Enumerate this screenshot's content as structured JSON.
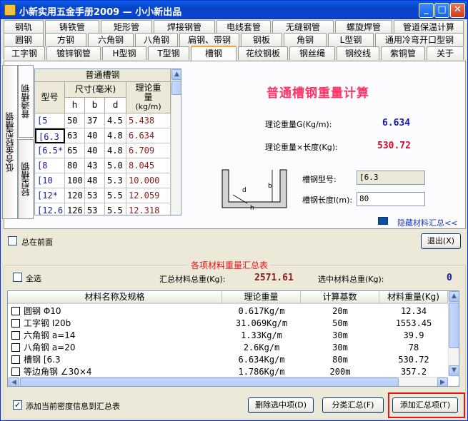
{
  "window": {
    "title": "小新实用五金手册2009 — 小小新出品",
    "min": "_",
    "max": "□",
    "close": "✕"
  },
  "tabs_row1": [
    "钢轨",
    "铸铁管",
    "矩形管",
    "焊接钢管",
    "电线套管",
    "无缝钢管",
    "螺旋焊管",
    "管道保温计算"
  ],
  "tabs_row2": [
    "圆钢",
    "方钢",
    "六角钢",
    "八角钢",
    "扁钢、带钢",
    "钢板",
    "角钢",
    "L型钢",
    "通用冷弯开口型钢"
  ],
  "tabs_row3": [
    "工字钢",
    "镀锌钢管",
    "H型钢",
    "T型钢",
    "槽钢",
    "花纹钢板",
    "钢丝绳",
    "钢绞线",
    "紫铜管",
    "关于"
  ],
  "vtabs": [
    "普通槽钢",
    "轻型槽钢",
    "低合金轻型槽钢"
  ],
  "grid": {
    "group_header": "普通槽钢",
    "col_model": "型号",
    "col_size": "尺寸(毫米)",
    "col_weight": "理论重量",
    "col_unit": "(kg/m)",
    "subcols": [
      "h",
      "b",
      "d"
    ],
    "rows": [
      [
        "[5",
        "50",
        "37",
        "4.5",
        "5.438"
      ],
      [
        "[6.3",
        "63",
        "40",
        "4.8",
        "6.634"
      ],
      [
        "[6.5*",
        "65",
        "40",
        "4.8",
        "6.709"
      ],
      [
        "[8",
        "80",
        "43",
        "5.0",
        "8.045"
      ],
      [
        "[10",
        "100",
        "48",
        "5.3",
        "10.000"
      ],
      [
        "[12*",
        "120",
        "53",
        "5.5",
        "12.059"
      ],
      [
        "[12.6",
        "126",
        "53",
        "5.5",
        "12.318"
      ]
    ]
  },
  "calc": {
    "heading": "普通槽钢重量计算",
    "weight_label": "理论重量G(Kg/m):",
    "weight_value": "6.634",
    "total_label": "理论重量×长度(Kg):",
    "total_value": "530.72",
    "model_label": "槽钢型号:",
    "model_value": "[6.3",
    "length_label": "槽钢长度l(m):",
    "length_value": "80",
    "hide_summary": "隐藏材料汇总<<",
    "diagram_labels": [
      "b",
      "d",
      "h"
    ]
  },
  "topmost_label": "总在前面",
  "exit_button": "退出(X)",
  "summary": {
    "title": "各项材料重量汇总表",
    "select_all": "全选",
    "total_label": "汇总材料总重(Kg):",
    "total_value": "2571.61",
    "selected_label": "选中材料总重(Kg):",
    "selected_value": "0",
    "columns": [
      "材料名称及规格",
      "理论重量",
      "计算基数",
      "材料重量(Kg)"
    ],
    "rows": [
      [
        "圆钢  Φ10",
        "0.617Kg/m",
        "20m",
        "12.34"
      ],
      [
        "工字钢  I20b",
        "31.069Kg/m",
        "50m",
        "1553.45"
      ],
      [
        "六角钢  a=14",
        "1.33Kg/m",
        "30m",
        "39.9"
      ],
      [
        "八角钢  a=20",
        "2.6Kg/m",
        "30m",
        "78"
      ],
      [
        "槽钢  [6.3",
        "6.634Kg/m",
        "80m",
        "530.72"
      ],
      [
        "等边角钢  ∠30×4",
        "1.786Kg/m",
        "200m",
        "357.2"
      ]
    ],
    "add_density_label": "添加当前密度信息到汇总表",
    "delete_button": "删除选中项(D)",
    "classify_button": "分类汇总(F)",
    "add_button": "添加汇总项(T)"
  },
  "colors": {
    "heading": "#ff3366",
    "weight_value": "#1a1aa8",
    "total_value": "#cc1133",
    "summary_title": "#e8141c",
    "highlight": "#e8141c"
  }
}
